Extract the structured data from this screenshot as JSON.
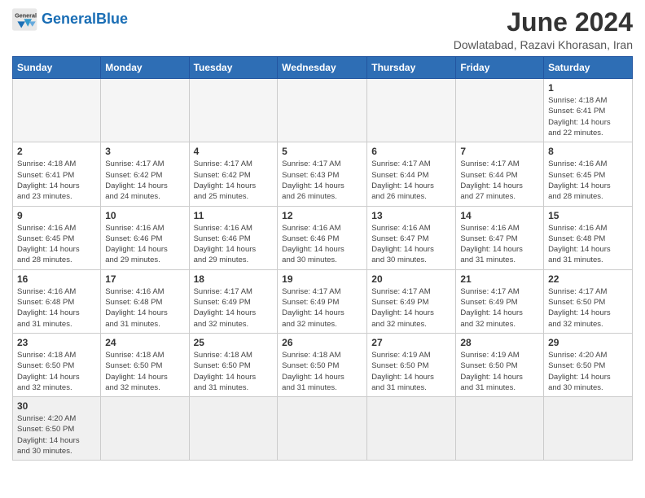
{
  "header": {
    "logo_general": "General",
    "logo_blue": "Blue",
    "month_title": "June 2024",
    "subtitle": "Dowlatabad, Razavi Khorasan, Iran"
  },
  "weekdays": [
    "Sunday",
    "Monday",
    "Tuesday",
    "Wednesday",
    "Thursday",
    "Friday",
    "Saturday"
  ],
  "days": [
    {
      "date": "",
      "info": ""
    },
    {
      "date": "",
      "info": ""
    },
    {
      "date": "",
      "info": ""
    },
    {
      "date": "",
      "info": ""
    },
    {
      "date": "",
      "info": ""
    },
    {
      "date": "",
      "info": ""
    },
    {
      "date": "1",
      "info": "Sunrise: 4:18 AM\nSunset: 6:41 PM\nDaylight: 14 hours\nand 22 minutes."
    },
    {
      "date": "2",
      "info": "Sunrise: 4:18 AM\nSunset: 6:41 PM\nDaylight: 14 hours\nand 23 minutes."
    },
    {
      "date": "3",
      "info": "Sunrise: 4:17 AM\nSunset: 6:42 PM\nDaylight: 14 hours\nand 24 minutes."
    },
    {
      "date": "4",
      "info": "Sunrise: 4:17 AM\nSunset: 6:42 PM\nDaylight: 14 hours\nand 25 minutes."
    },
    {
      "date": "5",
      "info": "Sunrise: 4:17 AM\nSunset: 6:43 PM\nDaylight: 14 hours\nand 26 minutes."
    },
    {
      "date": "6",
      "info": "Sunrise: 4:17 AM\nSunset: 6:44 PM\nDaylight: 14 hours\nand 26 minutes."
    },
    {
      "date": "7",
      "info": "Sunrise: 4:17 AM\nSunset: 6:44 PM\nDaylight: 14 hours\nand 27 minutes."
    },
    {
      "date": "8",
      "info": "Sunrise: 4:16 AM\nSunset: 6:45 PM\nDaylight: 14 hours\nand 28 minutes."
    },
    {
      "date": "9",
      "info": "Sunrise: 4:16 AM\nSunset: 6:45 PM\nDaylight: 14 hours\nand 28 minutes."
    },
    {
      "date": "10",
      "info": "Sunrise: 4:16 AM\nSunset: 6:46 PM\nDaylight: 14 hours\nand 29 minutes."
    },
    {
      "date": "11",
      "info": "Sunrise: 4:16 AM\nSunset: 6:46 PM\nDaylight: 14 hours\nand 29 minutes."
    },
    {
      "date": "12",
      "info": "Sunrise: 4:16 AM\nSunset: 6:46 PM\nDaylight: 14 hours\nand 30 minutes."
    },
    {
      "date": "13",
      "info": "Sunrise: 4:16 AM\nSunset: 6:47 PM\nDaylight: 14 hours\nand 30 minutes."
    },
    {
      "date": "14",
      "info": "Sunrise: 4:16 AM\nSunset: 6:47 PM\nDaylight: 14 hours\nand 31 minutes."
    },
    {
      "date": "15",
      "info": "Sunrise: 4:16 AM\nSunset: 6:48 PM\nDaylight: 14 hours\nand 31 minutes."
    },
    {
      "date": "16",
      "info": "Sunrise: 4:16 AM\nSunset: 6:48 PM\nDaylight: 14 hours\nand 31 minutes."
    },
    {
      "date": "17",
      "info": "Sunrise: 4:16 AM\nSunset: 6:48 PM\nDaylight: 14 hours\nand 31 minutes."
    },
    {
      "date": "18",
      "info": "Sunrise: 4:17 AM\nSunset: 6:49 PM\nDaylight: 14 hours\nand 32 minutes."
    },
    {
      "date": "19",
      "info": "Sunrise: 4:17 AM\nSunset: 6:49 PM\nDaylight: 14 hours\nand 32 minutes."
    },
    {
      "date": "20",
      "info": "Sunrise: 4:17 AM\nSunset: 6:49 PM\nDaylight: 14 hours\nand 32 minutes."
    },
    {
      "date": "21",
      "info": "Sunrise: 4:17 AM\nSunset: 6:49 PM\nDaylight: 14 hours\nand 32 minutes."
    },
    {
      "date": "22",
      "info": "Sunrise: 4:17 AM\nSunset: 6:50 PM\nDaylight: 14 hours\nand 32 minutes."
    },
    {
      "date": "23",
      "info": "Sunrise: 4:18 AM\nSunset: 6:50 PM\nDaylight: 14 hours\nand 32 minutes."
    },
    {
      "date": "24",
      "info": "Sunrise: 4:18 AM\nSunset: 6:50 PM\nDaylight: 14 hours\nand 32 minutes."
    },
    {
      "date": "25",
      "info": "Sunrise: 4:18 AM\nSunset: 6:50 PM\nDaylight: 14 hours\nand 31 minutes."
    },
    {
      "date": "26",
      "info": "Sunrise: 4:18 AM\nSunset: 6:50 PM\nDaylight: 14 hours\nand 31 minutes."
    },
    {
      "date": "27",
      "info": "Sunrise: 4:19 AM\nSunset: 6:50 PM\nDaylight: 14 hours\nand 31 minutes."
    },
    {
      "date": "28",
      "info": "Sunrise: 4:19 AM\nSunset: 6:50 PM\nDaylight: 14 hours\nand 31 minutes."
    },
    {
      "date": "29",
      "info": "Sunrise: 4:20 AM\nSunset: 6:50 PM\nDaylight: 14 hours\nand 30 minutes."
    },
    {
      "date": "30",
      "info": "Sunrise: 4:20 AM\nSunset: 6:50 PM\nDaylight: 14 hours\nand 30 minutes."
    }
  ]
}
